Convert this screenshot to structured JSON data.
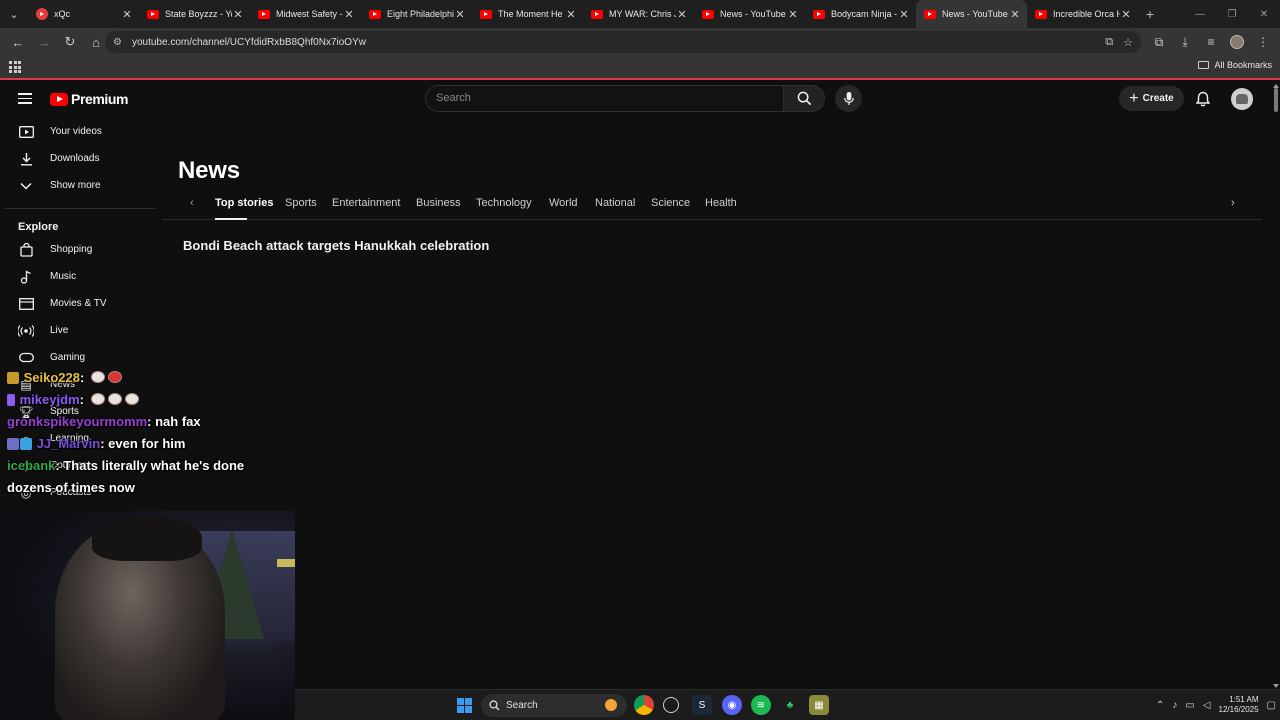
{
  "browser": {
    "tabs": [
      {
        "title": "xQc",
        "active": false,
        "favicon": "twitch-like-icon"
      },
      {
        "title": "State Boyzzz - Yo",
        "active": false,
        "favicon": "youtube-icon"
      },
      {
        "title": "Midwest Safety -",
        "active": false,
        "favicon": "youtube-icon"
      },
      {
        "title": "Eight Philadelphi",
        "active": false,
        "favicon": "youtube-icon"
      },
      {
        "title": "The Moment He",
        "active": false,
        "favicon": "youtube-icon"
      },
      {
        "title": "MY WAR: Chris Jo",
        "active": false,
        "favicon": "youtube-icon"
      },
      {
        "title": "News - YouTube",
        "active": false,
        "favicon": "youtube-icon"
      },
      {
        "title": "Bodycam Ninja -",
        "active": false,
        "favicon": "youtube-icon"
      },
      {
        "title": "News - YouTube",
        "active": true,
        "favicon": "youtube-icon"
      },
      {
        "title": "Incredible Orca H",
        "active": false,
        "favicon": "youtube-icon"
      }
    ],
    "url": "youtube.com/channel/UCYfdidRxbB8Qhf0Nx7ioOYw",
    "bookmarks_label": "All Bookmarks"
  },
  "youtube": {
    "logo_text": "Premium",
    "search_placeholder": "Search",
    "create_label": "Create",
    "sidebar": {
      "items_top": [
        {
          "label": "Your videos",
          "icon": "play-square-icon"
        },
        {
          "label": "Downloads",
          "icon": "download-icon"
        },
        {
          "label": "Show more",
          "icon": "chevron-down-icon"
        }
      ],
      "explore_heading": "Explore",
      "explore_items": [
        {
          "label": "Shopping",
          "icon": "shopping-bag-icon"
        },
        {
          "label": "Music",
          "icon": "music-note-icon"
        },
        {
          "label": "Movies & TV",
          "icon": "film-icon"
        },
        {
          "label": "Live",
          "icon": "live-icon"
        },
        {
          "label": "Gaming",
          "icon": "gamepad-icon"
        },
        {
          "label": "News",
          "icon": "newspaper-icon"
        },
        {
          "label": "Sports",
          "icon": "trophy-icon"
        },
        {
          "label": "Learning",
          "icon": "lightbulb-icon"
        },
        {
          "label": "Courses",
          "icon": "courses-icon"
        },
        {
          "label": "Podcasts",
          "icon": "podcast-icon"
        }
      ]
    },
    "page_title": "News",
    "news_tabs": [
      "Top stories",
      "Sports",
      "Entertainment",
      "Business",
      "Technology",
      "World",
      "National",
      "Science",
      "Health"
    ],
    "selected_tab": "Top stories",
    "headline": "Bondi Beach attack targets Hanukkah celebration"
  },
  "chat": [
    {
      "user": "Seiko228",
      "user_color": "#e8c23a",
      "message": ":",
      "emotes": 2
    },
    {
      "user": "mikeyjdm",
      "user_color": "#8a5cf5",
      "message": ":",
      "emotes": 3
    },
    {
      "user": "gronkspikeyourmomm",
      "user_color": "#9b3fd6",
      "message": ": nah fax",
      "emotes": 0
    },
    {
      "user": "JJ_Marvin",
      "user_color": "#7a4fe0",
      "message": ": even for him",
      "emotes": 0
    },
    {
      "user": "icebank",
      "user_color": "#2fa84a",
      "message": ": Thats literally what he's done",
      "emotes": 0
    },
    {
      "user": "",
      "user_color": "#ffffff",
      "message": "dozens of times now",
      "emotes": 0
    }
  ],
  "taskbar": {
    "search_label": "Search",
    "time": "1:51 AM",
    "date": "12/16/2025",
    "apps": [
      "chrome-icon",
      "spotify-like-icon",
      "steam-icon",
      "discord-icon",
      "spotify-icon",
      "robinhood-icon",
      "app-icon"
    ]
  }
}
